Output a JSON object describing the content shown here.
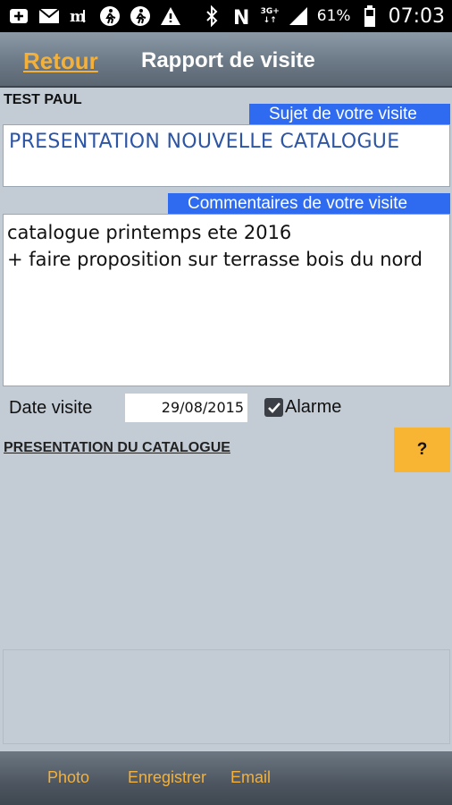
{
  "status_bar": {
    "battery": "61%",
    "time": "07:03",
    "network_top": "3G+",
    "network_bottom": "↓↑",
    "icons": [
      "add-box-icon",
      "email-icon",
      "newspaper-icon",
      "pedestrian-icon",
      "pedestrian-icon",
      "warning-icon",
      "bluetooth-icon",
      "nfc-icon",
      "signal-icon",
      "battery-icon"
    ]
  },
  "header": {
    "back_label": "Retour",
    "title": "Rapport de visite"
  },
  "user_name": "TEST PAUL",
  "subject": {
    "label": "Sujet de votre visite",
    "value": "PRESENTATION NOUVELLE CATALOGUE"
  },
  "comments": {
    "label": "Commentaires de votre visite",
    "value": "catalogue printemps ete 2016\n+ faire proposition sur terrasse bois du nord"
  },
  "date": {
    "label": "Date visite",
    "value": "29/08/2015"
  },
  "alarm": {
    "label": "Alarme",
    "checked": true
  },
  "section_link": "PRESENTATION DU CATALOGUE",
  "help_button": "?",
  "bottom_bar": {
    "photo": "Photo",
    "save": "Enregistrer",
    "email": "Email"
  },
  "colors": {
    "accent": "#f3b13b",
    "label_blue": "#2f6bf0",
    "subject_text": "#2d55a6",
    "help_bg": "#f8b433"
  }
}
